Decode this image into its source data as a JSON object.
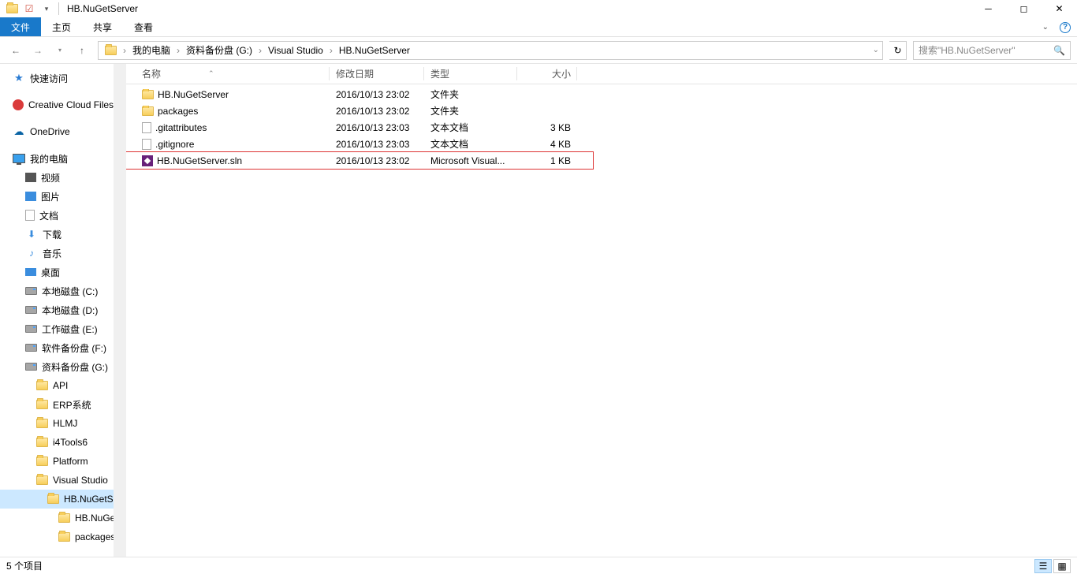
{
  "window": {
    "title": "HB.NuGetServer"
  },
  "ribbon": {
    "file": "文件",
    "tabs": [
      "主页",
      "共享",
      "查看"
    ]
  },
  "breadcrumb": {
    "segments": [
      "我的电脑",
      "资料备份盘 (G:)",
      "Visual Studio",
      "HB.NuGetServer"
    ]
  },
  "search": {
    "placeholder": "搜索\"HB.NuGetServer\""
  },
  "columns": {
    "name": "名称",
    "date": "修改日期",
    "type": "类型",
    "size": "大小"
  },
  "sidebar": {
    "quick_access": "快速访问",
    "creative_cloud": "Creative Cloud Files",
    "onedrive": "OneDrive",
    "my_pc": "我的电脑",
    "pc_children": [
      "视频",
      "图片",
      "文档",
      "下载",
      "音乐",
      "桌面"
    ],
    "drives": [
      "本地磁盘 (C:)",
      "本地磁盘 (D:)",
      "工作磁盘 (E:)",
      "软件备份盘 (F:)",
      "资料备份盘 (G:)"
    ],
    "g_children": [
      "API",
      "ERP系统",
      "HLMJ",
      "i4Tools6",
      "Platform",
      "Visual Studio"
    ],
    "vs_children": [
      "HB.NuGetServer"
    ],
    "nuget_children": [
      "HB.NuGetServer",
      "packages"
    ]
  },
  "files": [
    {
      "icon": "folder",
      "name": "HB.NuGetServer",
      "date": "2016/10/13 23:02",
      "type": "文件夹",
      "size": ""
    },
    {
      "icon": "folder",
      "name": "packages",
      "date": "2016/10/13 23:02",
      "type": "文件夹",
      "size": ""
    },
    {
      "icon": "file",
      "name": ".gitattributes",
      "date": "2016/10/13 23:03",
      "type": "文本文档",
      "size": "3 KB"
    },
    {
      "icon": "file",
      "name": ".gitignore",
      "date": "2016/10/13 23:03",
      "type": "文本文档",
      "size": "4 KB"
    },
    {
      "icon": "sln",
      "name": "HB.NuGetServer.sln",
      "date": "2016/10/13 23:02",
      "type": "Microsoft Visual...",
      "size": "1 KB",
      "highlight": true
    }
  ],
  "status": {
    "text": "5 个项目"
  }
}
